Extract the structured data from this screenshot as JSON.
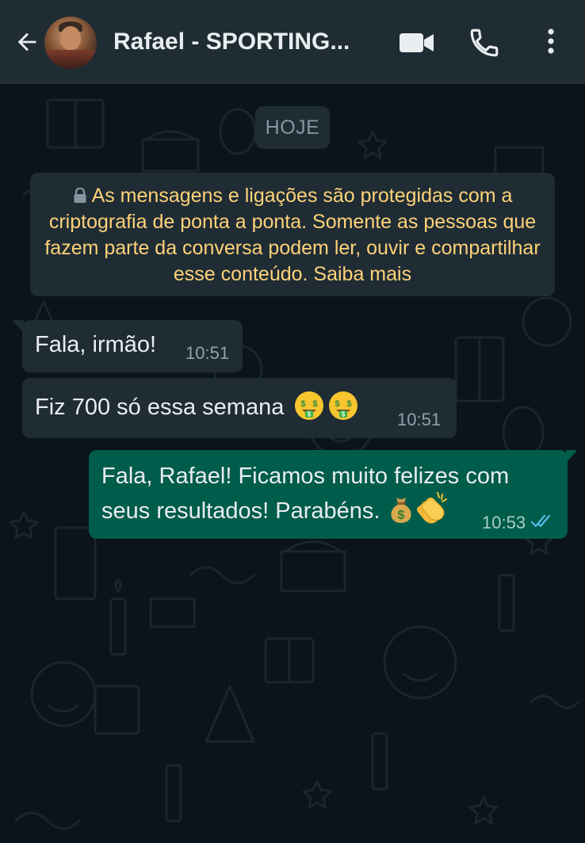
{
  "header": {
    "contact_name": "Rafael - SPORTING...",
    "icons": {
      "back": "arrow-back-icon",
      "video": "video-camera-icon",
      "call": "phone-icon",
      "menu": "more-vertical-icon"
    }
  },
  "chat": {
    "date_label": "HOJE",
    "security_notice": "As mensagens e ligações são protegidas com a criptografia de ponta a ponta. Somente as pessoas que fazem parte da conversa podem ler, ouvir e compartilhar esse conteúdo. Saiba mais",
    "messages": [
      {
        "direction": "incoming",
        "text": "Fala, irmão!",
        "time": "10:51"
      },
      {
        "direction": "incoming",
        "text": "Fiz 700 só essa semana",
        "emojis": [
          "money-mouth-face-emoji",
          "money-mouth-face-emoji"
        ],
        "time": "10:51"
      },
      {
        "direction": "outgoing",
        "text_line1": "Fala, Rafael! Ficamos muito felizes com",
        "text_line2": "seus resultados! Parabéns.",
        "emojis": [
          "money-bag-emoji",
          "clapping-hands-emoji"
        ],
        "time": "10:53",
        "status": "read"
      }
    ]
  },
  "colors": {
    "header_bg": "#1f2c34",
    "chat_bg": "#0b141a",
    "incoming_bubble": "#1f2c34",
    "outgoing_bubble": "#005c4b",
    "notice_text": "#ffd279",
    "read_tick": "#53bdeb"
  }
}
